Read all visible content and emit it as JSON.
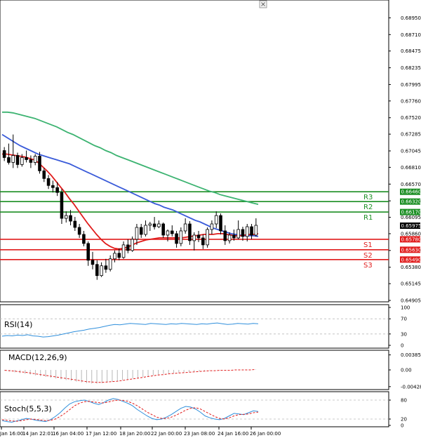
{
  "chart_data": [
    {
      "type": "candlestick",
      "panel": "price",
      "y_ticks": [
        "0.68950",
        "0.68710",
        "0.68475",
        "0.68235",
        "0.67995",
        "0.67760",
        "0.67520",
        "0.67285",
        "0.67045",
        "0.66810",
        "0.66570",
        "0.66330",
        "0.66095",
        "0.65860",
        "0.65620",
        "0.65380",
        "0.65145",
        "0.64905"
      ],
      "ylim": [
        0.64905,
        0.69185
      ],
      "x_ticks": [
        "Jan 16:00",
        "14 Jan 22:01",
        "16 Jan 04:00",
        "17 Jan 12:00",
        "18 Jan 20:00",
        "22 Jan 00:00",
        "23 Jan 08:00",
        "24 Jan 16:00",
        "26 Jan 00:00"
      ],
      "candles": [
        [
          0.6705,
          0.671,
          0.669,
          0.6695
        ],
        [
          0.6695,
          0.6715,
          0.6685,
          0.6688
        ],
        [
          0.6688,
          0.6728,
          0.668,
          0.6698
        ],
        [
          0.6698,
          0.6702,
          0.668,
          0.6685
        ],
        [
          0.6685,
          0.67,
          0.6682,
          0.6695
        ],
        [
          0.6695,
          0.6705,
          0.6688,
          0.6692
        ],
        [
          0.6692,
          0.6698,
          0.668,
          0.6688
        ],
        [
          0.6688,
          0.67,
          0.6684,
          0.6697
        ],
        [
          0.6697,
          0.6703,
          0.6672,
          0.6676
        ],
        [
          0.6676,
          0.668,
          0.666,
          0.6665
        ],
        [
          0.6665,
          0.667,
          0.665,
          0.6655
        ],
        [
          0.6655,
          0.6662,
          0.6645,
          0.6652
        ],
        [
          0.6652,
          0.666,
          0.664,
          0.6645
        ],
        [
          0.6645,
          0.665,
          0.66,
          0.6608
        ],
        [
          0.6608,
          0.6618,
          0.6602,
          0.6612
        ],
        [
          0.6612,
          0.662,
          0.6598,
          0.6604
        ],
        [
          0.6604,
          0.661,
          0.659,
          0.6595
        ],
        [
          0.6595,
          0.66,
          0.658,
          0.6585
        ],
        [
          0.6585,
          0.659,
          0.6568,
          0.6572
        ],
        [
          0.6572,
          0.6575,
          0.654,
          0.6548
        ],
        [
          0.6548,
          0.656,
          0.6535,
          0.6542
        ],
        [
          0.6542,
          0.6548,
          0.652,
          0.6526
        ],
        [
          0.6526,
          0.6545,
          0.6524,
          0.654
        ],
        [
          0.654,
          0.655,
          0.653,
          0.6535
        ],
        [
          0.6535,
          0.6555,
          0.6532,
          0.655
        ],
        [
          0.655,
          0.6562,
          0.6545,
          0.6558
        ],
        [
          0.6558,
          0.6565,
          0.6548,
          0.6552
        ],
        [
          0.6552,
          0.6575,
          0.655,
          0.657
        ],
        [
          0.657,
          0.6578,
          0.6558,
          0.6562
        ],
        [
          0.6562,
          0.6582,
          0.656,
          0.6578
        ],
        [
          0.6578,
          0.66,
          0.657,
          0.6595
        ],
        [
          0.6595,
          0.66,
          0.658,
          0.6585
        ],
        [
          0.6585,
          0.6605,
          0.6582,
          0.6598
        ],
        [
          0.6598,
          0.6603,
          0.659,
          0.66
        ],
        [
          0.66,
          0.661,
          0.6592,
          0.6596
        ],
        [
          0.6596,
          0.6605,
          0.6594,
          0.66
        ],
        [
          0.66,
          0.6602,
          0.658,
          0.6584
        ],
        [
          0.6584,
          0.6592,
          0.6575,
          0.659
        ],
        [
          0.659,
          0.6598,
          0.6582,
          0.6586
        ],
        [
          0.6586,
          0.659,
          0.6566,
          0.6572
        ],
        [
          0.6572,
          0.6595,
          0.6568,
          0.659
        ],
        [
          0.659,
          0.6608,
          0.6586,
          0.66
        ],
        [
          0.66,
          0.6604,
          0.657,
          0.6576
        ],
        [
          0.6576,
          0.6588,
          0.6562,
          0.6584
        ],
        [
          0.6584,
          0.659,
          0.6574,
          0.658
        ],
        [
          0.658,
          0.6585,
          0.6564,
          0.657
        ],
        [
          0.657,
          0.6595,
          0.6566,
          0.6592
        ],
        [
          0.6592,
          0.6605,
          0.6585,
          0.66
        ],
        [
          0.66,
          0.6618,
          0.6594,
          0.6612
        ],
        [
          0.6612,
          0.6615,
          0.6585,
          0.659
        ],
        [
          0.659,
          0.6598,
          0.657,
          0.6576
        ],
        [
          0.6576,
          0.6588,
          0.6572,
          0.6584
        ],
        [
          0.6584,
          0.6592,
          0.6576,
          0.658
        ],
        [
          0.658,
          0.6605,
          0.6578,
          0.6592
        ],
        [
          0.6592,
          0.6596,
          0.6576,
          0.6582
        ],
        [
          0.6582,
          0.66,
          0.6575,
          0.6596
        ],
        [
          0.6596,
          0.66,
          0.6578,
          0.6584
        ],
        [
          0.6584,
          0.6608,
          0.6582,
          0.6598
        ]
      ],
      "series": [
        {
          "name": "",
          "color": "#3cb371",
          "values": [
            0.676,
            0.676,
            0.6759,
            0.6757,
            0.6755,
            0.6753,
            0.6751,
            0.6748,
            0.6745,
            0.6742,
            0.6739,
            0.6735,
            0.6731,
            0.6728,
            0.6724,
            0.672,
            0.6716,
            0.6712,
            0.6709,
            0.6705,
            0.6702,
            0.6698,
            0.6695,
            0.6692,
            0.6689,
            0.6686,
            0.6683,
            0.668,
            0.6677,
            0.6674,
            0.6671,
            0.6668,
            0.6665,
            0.6662,
            0.6659,
            0.6656,
            0.6653,
            0.665,
            0.6647,
            0.6645,
            0.6642,
            0.664,
            0.6638,
            0.6636,
            0.6634,
            0.6632,
            0.663,
            0.6628
          ]
        },
        {
          "name": "",
          "color": "#3a5bd9",
          "values": [
            0.6728,
            0.6724,
            0.672,
            0.6716,
            0.6712,
            0.6709,
            0.6706,
            0.6703,
            0.67,
            0.6698,
            0.6696,
            0.6694,
            0.6692,
            0.669,
            0.6688,
            0.6686,
            0.6683,
            0.668,
            0.6677,
            0.6674,
            0.6671,
            0.6668,
            0.6665,
            0.6662,
            0.6659,
            0.6656,
            0.6653,
            0.665,
            0.6647,
            0.6644,
            0.6641,
            0.6638,
            0.6635,
            0.6632,
            0.6629,
            0.6627,
            0.6624,
            0.6622,
            0.662,
            0.6617,
            0.6614,
            0.6611,
            0.6608,
            0.6605,
            0.6603,
            0.66,
            0.6597,
            0.6594,
            0.6592,
            0.659,
            0.6588,
            0.6586,
            0.6585,
            0.6584,
            0.6583,
            0.6583,
            0.6583,
            0.6582
          ]
        },
        {
          "name": "",
          "color": "#e01b1b",
          "values": [
            0.67,
            0.67,
            0.6699,
            0.6698,
            0.6697,
            0.6696,
            0.6694,
            0.6692,
            0.6688,
            0.6682,
            0.6676,
            0.6669,
            0.6661,
            0.6653,
            0.6645,
            0.6636,
            0.6628,
            0.6619,
            0.661,
            0.6601,
            0.6593,
            0.6585,
            0.6578,
            0.6572,
            0.6568,
            0.6565,
            0.6564,
            0.6565,
            0.6567,
            0.657,
            0.6573,
            0.6575,
            0.6577,
            0.6578,
            0.6579,
            0.658,
            0.658,
            0.658,
            0.658,
            0.658,
            0.658,
            0.6581,
            0.6582,
            0.6583,
            0.6584,
            0.6585,
            0.6585,
            0.6585,
            0.6586,
            0.6586,
            0.6585,
            0.6584,
            0.6583,
            0.6583,
            0.6584,
            0.6585,
            0.6585,
            0.6586
          ]
        }
      ],
      "levels": [
        {
          "label": "R3",
          "value": "0.66460",
          "color": "#1b8e23"
        },
        {
          "label": "R2",
          "value": "0.66320",
          "color": "#1b8e23"
        },
        {
          "label": "R1",
          "value": "0.66170",
          "color": "#1b8e23"
        },
        {
          "label": "S1",
          "value": "0.65780",
          "color": "#e01b1b"
        },
        {
          "label": "S2",
          "value": "0.65630",
          "color": "#e01b1b"
        },
        {
          "label": "S3",
          "value": "0.65490",
          "color": "#e01b1b"
        }
      ],
      "last_price": "0.65975"
    },
    {
      "type": "line",
      "panel": "rsi",
      "title": "RSI(14)",
      "y_ticks": [
        "100",
        "70",
        "30",
        "0"
      ],
      "ylim": [
        0,
        100
      ],
      "color": "#2f8fdc",
      "values": [
        24,
        26,
        25,
        27,
        26,
        28,
        25,
        24,
        22,
        23,
        25,
        27,
        30,
        33,
        36,
        38,
        40,
        43,
        45,
        47,
        50,
        53,
        55,
        54,
        56,
        58,
        57,
        56,
        55,
        58,
        57,
        56,
        55,
        57,
        56,
        58,
        57,
        56,
        55,
        57,
        56,
        58,
        59,
        57,
        55,
        56,
        58,
        57,
        56,
        58,
        57
      ]
    },
    {
      "type": "bar",
      "panel": "macd",
      "title": "MACD(12,26,9)",
      "y_ticks": [
        "0.003851",
        "0.00",
        "-0.004287"
      ],
      "ylim": [
        -0.0045,
        0.0045
      ],
      "bar_values": [
        -0.0002,
        -0.0004,
        -0.0006,
        -0.0008,
        -0.001,
        -0.0012,
        -0.0014,
        -0.0016,
        -0.0018,
        -0.002,
        -0.0022,
        -0.0024,
        -0.0026,
        -0.0028,
        -0.003,
        -0.0032,
        -0.0034,
        -0.0035,
        -0.0035,
        -0.0034,
        -0.0032,
        -0.003,
        -0.0028,
        -0.0026,
        -0.0024,
        -0.0022,
        -0.002,
        -0.0018,
        -0.0016,
        -0.0014,
        -0.0012,
        -0.001,
        -0.0009,
        -0.0008,
        -0.0007,
        -0.0006,
        -0.0005,
        -0.0004,
        -0.0003,
        -0.0002,
        -0.0001,
        0.0,
        -0.0001,
        -0.0001,
        0.0,
        0.0,
        0.0,
        0.0001,
        0.0001,
        0.0001
      ],
      "signal_values": [
        -0.0001,
        -0.0002,
        -0.0003,
        -0.0005,
        -0.0006,
        -0.0008,
        -0.001,
        -0.0012,
        -0.0014,
        -0.0016,
        -0.0018,
        -0.002,
        -0.0022,
        -0.0024,
        -0.0026,
        -0.0028,
        -0.003,
        -0.0031,
        -0.0032,
        -0.0032,
        -0.0031,
        -0.003,
        -0.0029,
        -0.0027,
        -0.0025,
        -0.0023,
        -0.0021,
        -0.0019,
        -0.0017,
        -0.0015,
        -0.0013,
        -0.0012,
        -0.001,
        -0.0009,
        -0.0008,
        -0.0007,
        -0.0006,
        -0.0005,
        -0.0004,
        -0.0003,
        -0.0002,
        -0.0002,
        -0.0001,
        -0.0001,
        -0.0001,
        0.0,
        0.0,
        0.0,
        0.0,
        0.0001
      ]
    },
    {
      "type": "line",
      "panel": "stoch",
      "title": "Stoch(5,5,3)",
      "y_ticks": [
        "80",
        "20",
        "0"
      ],
      "ylim": [
        0,
        100
      ],
      "main_color": "#2f8fdc",
      "signal_color": "#e01b1b",
      "main": [
        15,
        12,
        10,
        14,
        18,
        22,
        20,
        16,
        14,
        12,
        18,
        28,
        40,
        55,
        68,
        75,
        78,
        80,
        76,
        70,
        66,
        72,
        80,
        85,
        82,
        76,
        70,
        62,
        50,
        40,
        30,
        22,
        18,
        20,
        26,
        34,
        44,
        54,
        60,
        58,
        52,
        42,
        30,
        24,
        20,
        18,
        22,
        30,
        38,
        36,
        34,
        40,
        46,
        44
      ],
      "signal": [
        18,
        16,
        14,
        13,
        15,
        18,
        20,
        19,
        17,
        15,
        16,
        20,
        28,
        38,
        50,
        62,
        70,
        75,
        76,
        74,
        72,
        71,
        74,
        78,
        80,
        79,
        76,
        70,
        62,
        52,
        42,
        34,
        26,
        22,
        22,
        26,
        32,
        40,
        48,
        54,
        56,
        52,
        44,
        36,
        28,
        22,
        20,
        24,
        30,
        34,
        35,
        36,
        40,
        42
      ]
    }
  ]
}
